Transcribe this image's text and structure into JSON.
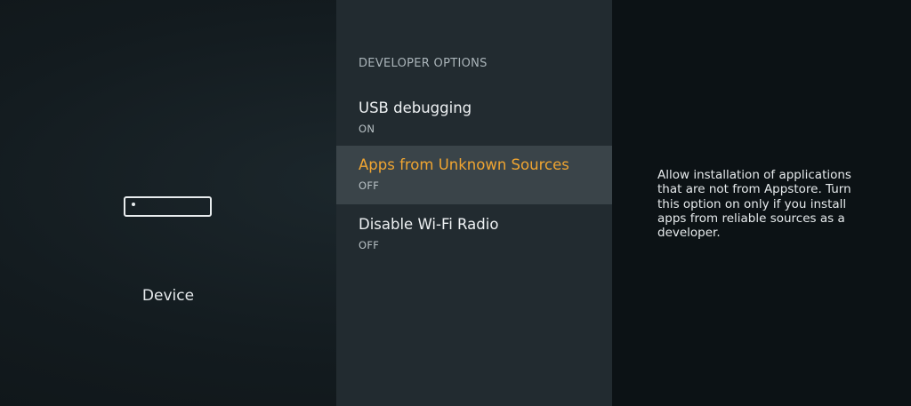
{
  "device_panel": {
    "label": "Device",
    "icon": "fire-tv-device-icon"
  },
  "developer_options": {
    "header": "DEVELOPER OPTIONS",
    "items": [
      {
        "title": "USB debugging",
        "status": "ON"
      },
      {
        "title": "Apps from Unknown Sources",
        "status": "OFF",
        "selected": true
      },
      {
        "title": "Disable Wi-Fi Radio",
        "status": "OFF"
      }
    ]
  },
  "description": {
    "text": "Allow installation of applications that are not from Appstore. Turn this option on only if you install apps from reliable sources as a developer."
  },
  "colors": {
    "highlight_text": "#f0a531",
    "selected_row": "#3a4449",
    "middle_panel": "#222b30",
    "background": "#131b1f"
  }
}
